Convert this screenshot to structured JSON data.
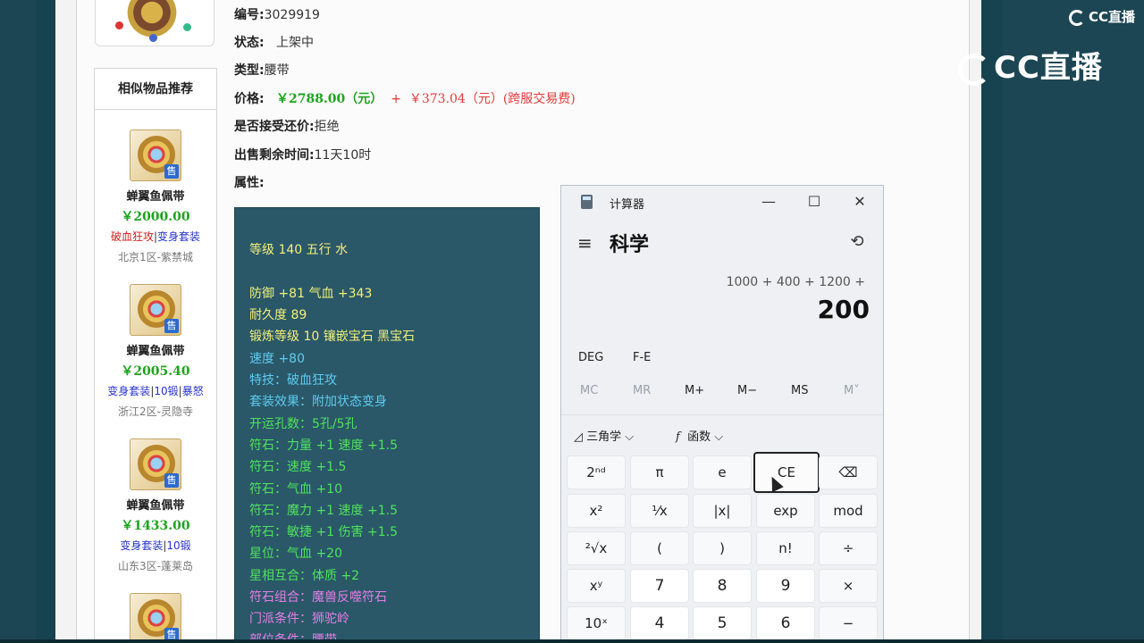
{
  "item": {
    "number_label": "编号:",
    "number_value": "3029919",
    "status_label": "状态:",
    "status_value": "上架中",
    "type_label": "类型:",
    "type_value": "腰带",
    "price_label": "价格:",
    "price_main": "￥2788.00（元）",
    "price_plus": "+",
    "price_fee": "￥373.04（元）(跨服交易费)",
    "counter_label": "是否接受还价:",
    "counter_value": "拒绝",
    "remaining_label": "出售剩余时间:",
    "remaining_value": "11天10时",
    "attr_label": "属性:"
  },
  "sidebar": {
    "title": "相似物品推荐",
    "items": [
      {
        "name": "蝉翼鱼佩带",
        "price": "￥2000.00",
        "tag1": "破血狂攻",
        "sep": "|",
        "tag2": "变身套装",
        "server": "北京1区-紫禁城"
      },
      {
        "name": "蝉翼鱼佩带",
        "price": "￥2005.40",
        "tag1": "变身套装",
        "sep1": "|",
        "tag2": "10锻",
        "sep2": "|",
        "tag3": "暴怒",
        "server": "浙江2区-灵隐寺"
      },
      {
        "name": "蝉翼鱼佩带",
        "price": "￥1433.00",
        "tag1": "变身套装",
        "sep": "|",
        "tag2": "10锻",
        "server": "山东3区-蓬莱岛"
      }
    ],
    "sale_badge": "售"
  },
  "attributes": [
    {
      "text": "等级 140 五行 水",
      "color": "#f2ef7a"
    },
    {
      "text": "防御 +81 气血 +343",
      "color": "#f2ef7a"
    },
    {
      "text": "耐久度 89",
      "color": "#f2ef7a"
    },
    {
      "text": "锻炼等级 10 镶嵌宝石 黑宝石",
      "color": "#f2ef7a"
    },
    {
      "text": "速度 +80",
      "color": "#5ecbf0"
    },
    {
      "text": "特技：破血狂攻",
      "color": "#5ecbf0"
    },
    {
      "text": "套装效果：附加状态变身",
      "color": "#5ecbf0"
    },
    {
      "text": "开运孔数：5孔/5孔",
      "color": "#4ee25e"
    },
    {
      "text": "符石：力量 +1 速度 +1.5",
      "color": "#4ee25e"
    },
    {
      "text": "符石：速度 +1.5",
      "color": "#4ee25e"
    },
    {
      "text": "符石：气血 +10",
      "color": "#4ee25e"
    },
    {
      "text": "符石：魔力 +1 速度 +1.5",
      "color": "#4ee25e"
    },
    {
      "text": "符石：敏捷 +1 伤害 +1.5",
      "color": "#4ee25e"
    },
    {
      "text": "星位：气血 +20",
      "color": "#4ee25e"
    },
    {
      "text": "星相互合：体质 +2",
      "color": "#4ee25e"
    },
    {
      "text": "符石组合：魔兽反噬符石",
      "color": "#e27ee6"
    },
    {
      "text": "门派条件：狮驼岭",
      "color": "#e27ee6"
    },
    {
      "text": "部位条件：腰带",
      "color": "#e27ee6"
    }
  ],
  "calculator": {
    "title": "计算器",
    "minimize": "—",
    "maximize": "☐",
    "close": "✕",
    "menu_icon": "hamburger-icon",
    "mode": "科学",
    "history_icon": "history-icon",
    "expression": "1000 + 400 + 1200 +",
    "result": "200",
    "deg": "DEG",
    "fe": "F-E",
    "mem": [
      "MC",
      "MR",
      "M+",
      "M−",
      "MS",
      "M˅"
    ],
    "trig": "三角学",
    "trig_caret": "⌵",
    "func": "函数",
    "func_caret": "⌵",
    "keys": [
      [
        "2ⁿᵈ",
        "π",
        "e",
        "CE",
        "⌫"
      ],
      [
        "x²",
        "¹⁄x",
        "|x|",
        "exp",
        "mod"
      ],
      [
        "²√x",
        "(",
        ")",
        "n!",
        "÷"
      ],
      [
        "xʸ",
        "7",
        "8",
        "9",
        "×"
      ],
      [
        "10ˣ",
        "4",
        "5",
        "6",
        "−"
      ]
    ]
  },
  "logos": {
    "small": "CC直播",
    "big": "CC直播"
  }
}
